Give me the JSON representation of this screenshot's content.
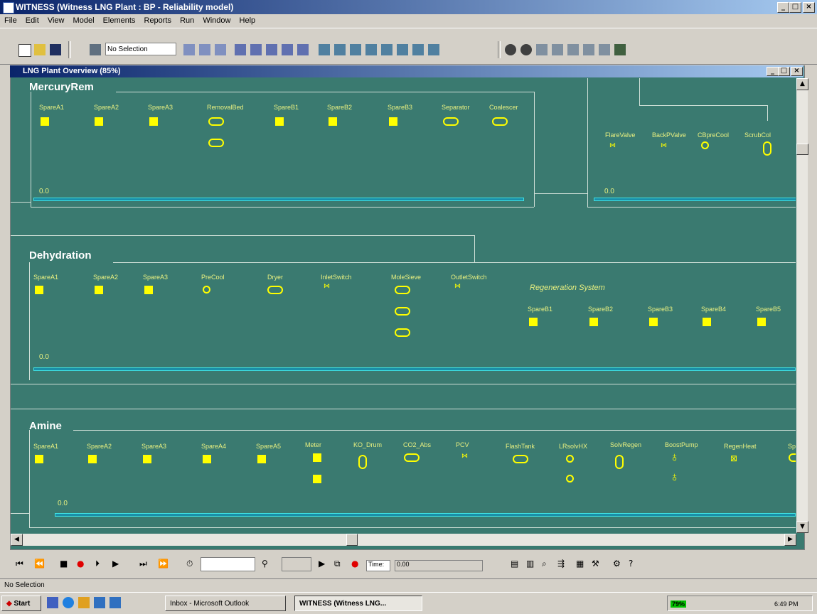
{
  "window": {
    "title": "WITNESS (Witness LNG Plant : BP - Reliability model)",
    "min": "_",
    "max": "□",
    "close": "×"
  },
  "menu": [
    "File",
    "Edit",
    "View",
    "Model",
    "Elements",
    "Reports",
    "Run",
    "Window",
    "Help"
  ],
  "toolbar": {
    "selection": "No Selection"
  },
  "child": {
    "title": "LNG Plant Overview (85%)"
  },
  "mercury": {
    "title": "MercuryRem",
    "labels": [
      "SpareA1",
      "SpareA2",
      "SpareA3",
      "RemovalBed",
      "SpareB1",
      "SpareB2",
      "SpareB3",
      "Separator",
      "Coalescer"
    ],
    "value": "0.0"
  },
  "right": {
    "labels": [
      "FlareValve",
      "BackPValve",
      "CBpreCool",
      "ScrubCol"
    ],
    "value": "0.0"
  },
  "dehy": {
    "title": "Dehydration",
    "labels": [
      "SpareA1",
      "SpareA2",
      "SpareA3",
      "PreCool",
      "Dryer",
      "InletSwitch",
      "MoleSieve",
      "OutletSwitch"
    ],
    "regen_title": "Regeneration System",
    "regen": [
      "SpareB1",
      "SpareB2",
      "SpareB3",
      "SpareB4",
      "SpareB5"
    ],
    "value": "0.0"
  },
  "amine": {
    "title": "Amine",
    "labels": [
      "SpareA1",
      "SpareA2",
      "SpareA3",
      "SpareA4",
      "SpareA5",
      "Meter",
      "KO_Drum",
      "CO2_Abs",
      "PCV",
      "FlashTank",
      "LRsolvHX",
      "SolvRegen",
      "BoostPump",
      "RegenHeat",
      "Sp"
    ],
    "value": "0.0"
  },
  "runbar": {
    "time_label": "Time:",
    "time_value": "0.00"
  },
  "status": {
    "text": "No Selection"
  },
  "taskbar": {
    "start": "Start",
    "outlook": "Inbox - Microsoft Outlook",
    "witness": "WITNESS (Witness LNG...",
    "battery": "79%",
    "clock": "6:49 PM"
  },
  "colors": {
    "canvas": "#3a7a70",
    "element": "#ffff00",
    "queue": "#40e0e0"
  }
}
